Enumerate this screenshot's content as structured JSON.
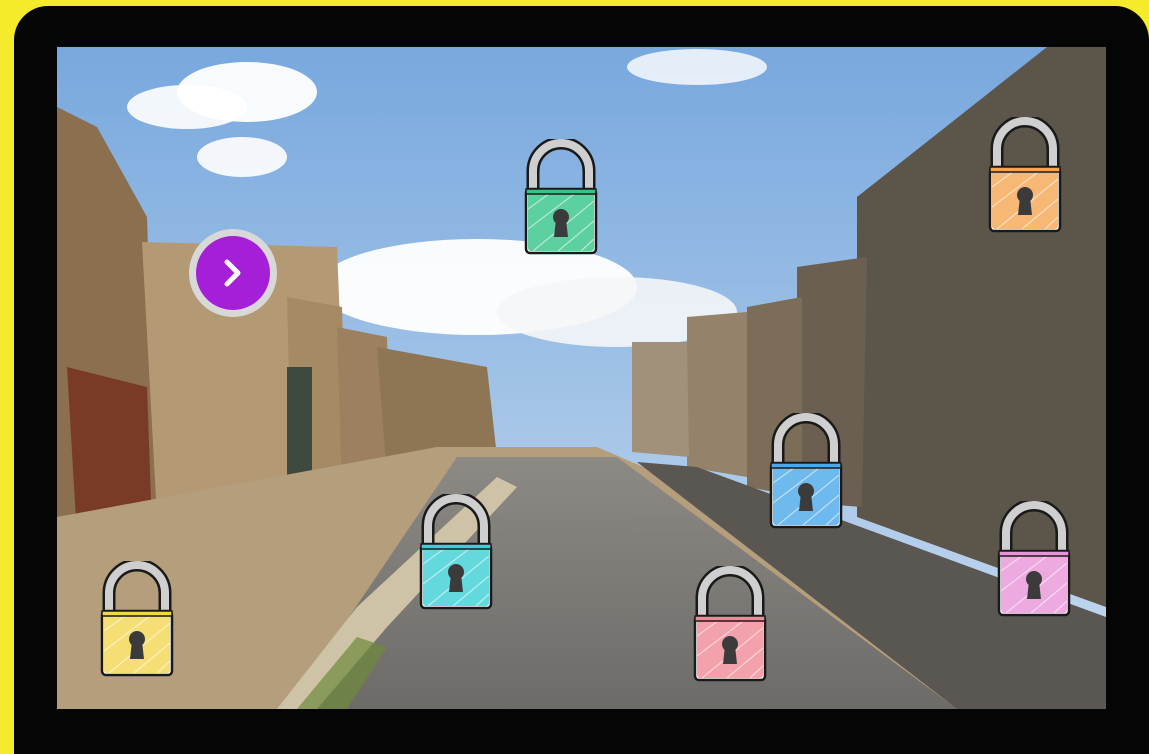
{
  "scene": {
    "description_icon": "pompeii-street-background",
    "sky_color": "#8fb8e3",
    "stone_color": "#a48a68"
  },
  "controls": {
    "next_icon": "chevron-right-icon",
    "next_color": "#a51fd9"
  },
  "locks": [
    {
      "id": "green",
      "color": "#33c488",
      "icon": "padlock-icon"
    },
    {
      "id": "orange",
      "color": "#f5a552",
      "icon": "padlock-icon"
    },
    {
      "id": "blue",
      "color": "#4aa8e8",
      "icon": "padlock-icon"
    },
    {
      "id": "cyan",
      "color": "#3ccfd6",
      "icon": "padlock-icon"
    },
    {
      "id": "pink",
      "color": "#e895d8",
      "icon": "padlock-icon"
    },
    {
      "id": "yellow",
      "color": "#f2d650",
      "icon": "padlock-icon"
    },
    {
      "id": "red",
      "color": "#f08a96",
      "icon": "padlock-icon"
    }
  ]
}
